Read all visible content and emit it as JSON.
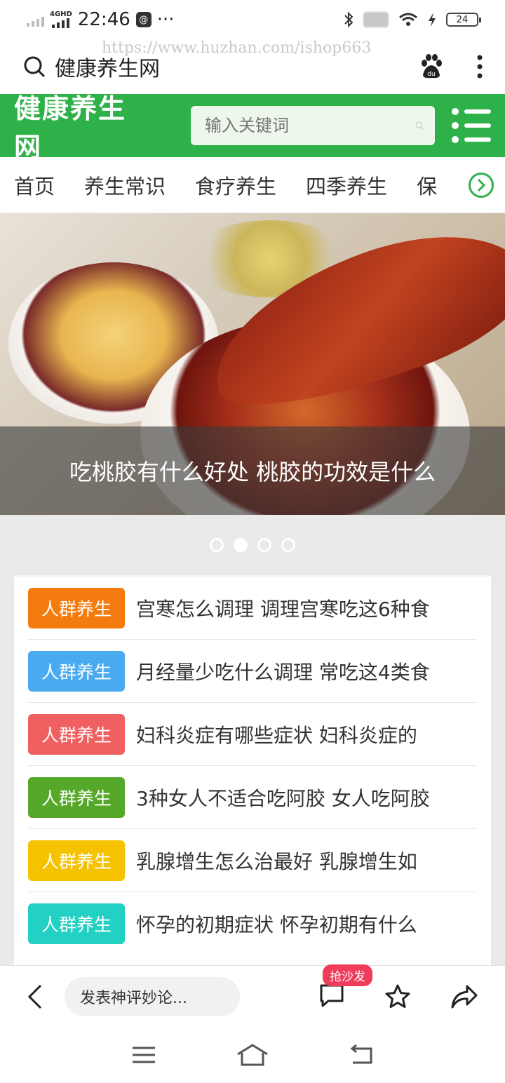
{
  "status_bar": {
    "network": "4GHD",
    "time": "22:46",
    "more": "···",
    "battery": "24"
  },
  "browser": {
    "title": "健康养生网",
    "watermark": "https://www.huzhan.com/ishop663"
  },
  "header": {
    "logo": "健康养生网",
    "search_placeholder": "输入关键词",
    "brand_color": "#2fb14a"
  },
  "nav": {
    "items": [
      "首页",
      "养生常识",
      "食疗养生",
      "四季养生",
      "保"
    ]
  },
  "banner": {
    "caption": "吃桃胶有什么好处 桃胶的功效是什么",
    "slide_count": 4,
    "active_index": 1
  },
  "articles": [
    {
      "tag": "人群养生",
      "tag_color": "#f47c0e",
      "title": "宫寒怎么调理 调理宫寒吃这6种食"
    },
    {
      "tag": "人群养生",
      "tag_color": "#4aaaf0",
      "title": "月经量少吃什么调理 常吃这4类食"
    },
    {
      "tag": "人群养生",
      "tag_color": "#f06060",
      "title": "妇科炎症有哪些症状 妇科炎症的"
    },
    {
      "tag": "人群养生",
      "tag_color": "#56a82a",
      "title": "3种女人不适合吃阿胶 女人吃阿胶"
    },
    {
      "tag": "人群养生",
      "tag_color": "#f5c200",
      "title": "乳腺增生怎么治最好 乳腺增生如"
    },
    {
      "tag": "人群养生",
      "tag_color": "#22d0c4",
      "title": "怀孕的初期症状 怀孕初期有什么"
    }
  ],
  "toolbar": {
    "comment_placeholder": "发表神评妙论...",
    "badge": "抢沙发"
  }
}
